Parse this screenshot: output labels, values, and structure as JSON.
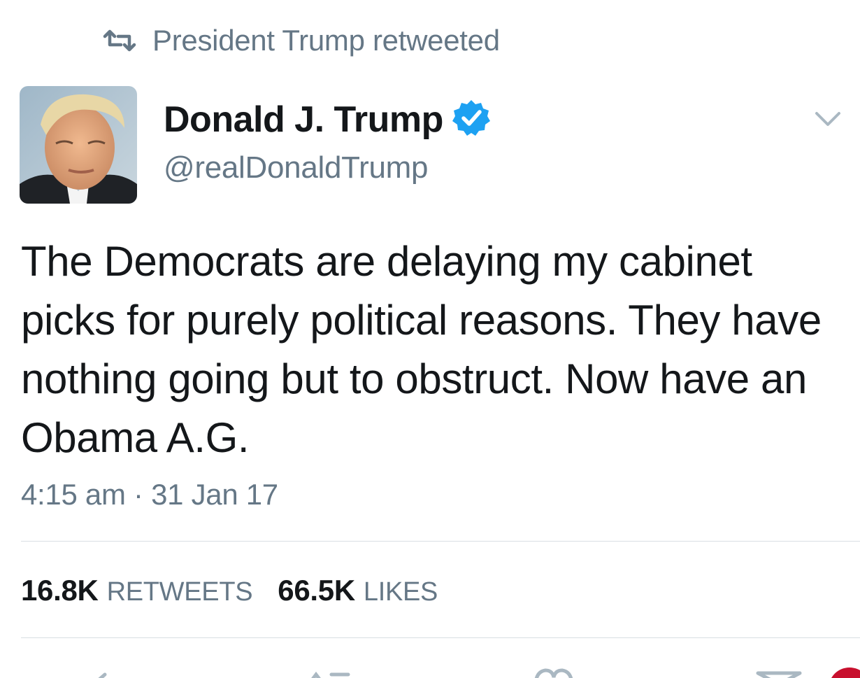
{
  "social_context": {
    "text": "President Trump retweeted",
    "icon": "retweet-icon"
  },
  "author": {
    "display_name": "Donald J. Trump",
    "handle": "@realDonaldTrump",
    "verified": true,
    "avatar": "profile-photo"
  },
  "tweet": {
    "text": "The Democrats are delaying my cabinet picks for purely political reasons. They have nothing going but to obstruct. Now have an Obama A.G.",
    "timestamp": "4:15 am · 31 Jan 17"
  },
  "stats": {
    "retweets_count": "16.8K",
    "retweets_label": "RETWEETS",
    "likes_count": "66.5K",
    "likes_label": "LIKES"
  },
  "actions": [
    "reply-icon",
    "retweet-icon",
    "like-icon",
    "direct-message-icon"
  ],
  "colors": {
    "secondary_text": "#657786",
    "primary_text": "#14171a",
    "verified_blue": "#1da1f2",
    "divider": "#d9dfe3"
  }
}
